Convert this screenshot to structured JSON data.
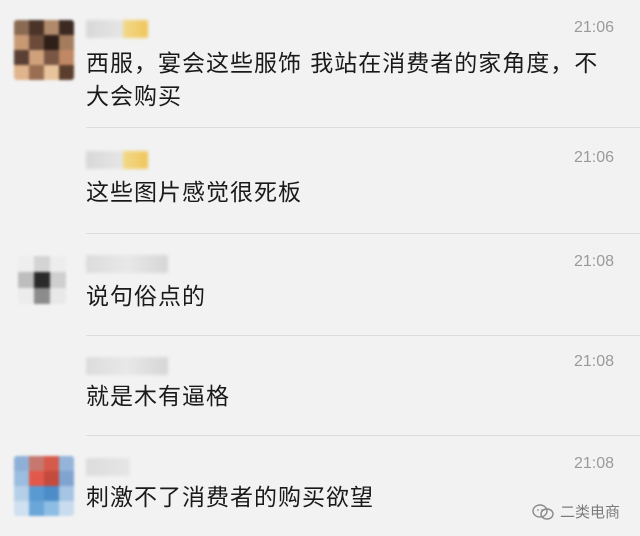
{
  "messages": [
    {
      "time": "21:06",
      "text": "西服，宴会这些服饰 我站在消费者的家角度，不大会购买"
    },
    {
      "time": "21:06",
      "text": "这些图片感觉很死板"
    },
    {
      "time": "21:08",
      "text": "说句俗点的"
    },
    {
      "time": "21:08",
      "text": "就是木有逼格"
    },
    {
      "time": "21:08",
      "text": "刺激不了消费者的购买欲望"
    }
  ],
  "watermark": {
    "label": "二类电商",
    "icon": "wechat-moments-icon"
  },
  "colors": {
    "background": "#f2f2f2",
    "text": "#1a1a1a",
    "time": "#9a9a9a",
    "divider": "#dddddd"
  }
}
